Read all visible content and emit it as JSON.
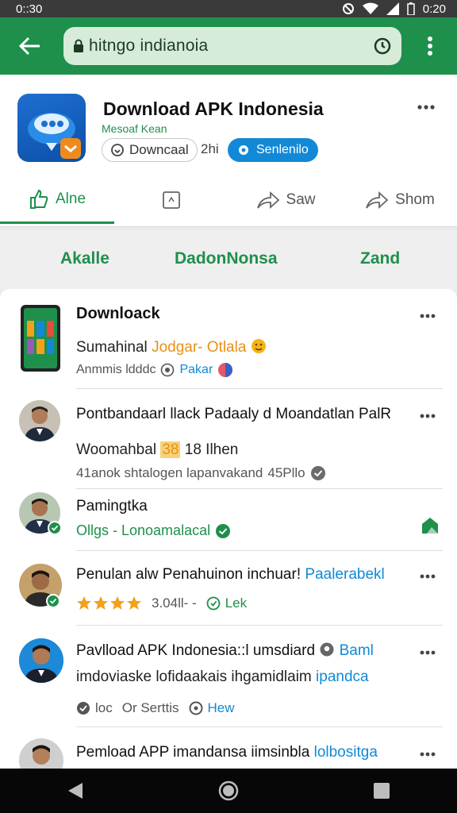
{
  "status_bar": {
    "time": "0::30",
    "right_time": "0:20"
  },
  "app_bar": {
    "url": "hitngo indianoia"
  },
  "header": {
    "title": "Download APK Indonesia",
    "subtitle": "Mesoaf Kean",
    "download_chip": "Downcaal",
    "time_label": "2hi",
    "action_chip": "Senlenilo",
    "actions": [
      "Alne",
      "Saw",
      "Shom"
    ]
  },
  "tabs": [
    "Akalle",
    "DadonNonsa",
    "Zand"
  ],
  "feed": {
    "items": [
      {
        "title": "Downloack",
        "line1_a": "Sumahinal",
        "line1_b": "Jodgar- Otlala",
        "meta_a": "Anmmis ldddc",
        "meta_b": "Pakar"
      },
      {
        "title": "Pontbandaarl llack Padaaly d Moandatlan PalR",
        "line1_a": "Woomahbal",
        "line1_b": "38",
        "line1_c": "18 Ilhen",
        "meta_a": "41anok shtalogen lapanvakand",
        "meta_b": "45Pllo"
      },
      {
        "title": "Pamingtka",
        "meta_a": "Ollgs - Lonoamalacal"
      },
      {
        "title_a": "Penulan alw Penahuinon inchuar!",
        "title_b": "Paalerabekl",
        "rating_value": 4,
        "rating_text": "3.04ll- -",
        "meta_b": "Lek"
      },
      {
        "title_a": "Pavlload APK Indonesia::l umsdiard",
        "title_b": "Baml",
        "line1_a": "imdoviaske lofidaakais ihgamidlaim",
        "line1_b": "ipandca",
        "meta_a": "loc",
        "meta_b": "Or Serttis",
        "meta_c": "Hew"
      },
      {
        "title_a": "Pemload APP imandansa iimsinbla",
        "title_b": "lolbositga"
      }
    ]
  },
  "colors": {
    "brand": "#1f8f4c",
    "accent": "#1289d6",
    "star": "#f3a118"
  }
}
